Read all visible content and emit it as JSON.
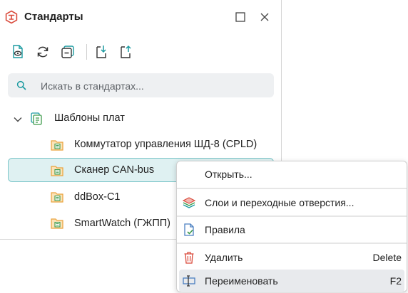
{
  "panel": {
    "title": "Стандарты",
    "icons": {
      "app": "standards-logo-icon",
      "maximize": "maximize-icon",
      "close": "close-icon"
    }
  },
  "toolbar": {
    "buttons": [
      {
        "name": "view-standard-button",
        "icon": "document-eye-icon"
      },
      {
        "name": "refresh-button",
        "icon": "refresh-icon"
      },
      {
        "name": "collapse-all-button",
        "icon": "collapse-icon"
      },
      {
        "name": "import-button",
        "icon": "import-icon"
      },
      {
        "name": "export-button",
        "icon": "export-icon"
      }
    ]
  },
  "search": {
    "placeholder": "Искать в стандартах...",
    "value": ""
  },
  "tree": {
    "root": {
      "label": "Шаблоны плат",
      "expanded": true,
      "icon": "board-templates-icon"
    },
    "items": [
      {
        "label": "Коммутатор управления ШД-8 (CPLD)",
        "icon": "folder-board-icon",
        "selected": false
      },
      {
        "label": "Сканер CAN-bus",
        "icon": "folder-board-icon",
        "selected": true
      },
      {
        "label": "ddBox-C1",
        "icon": "folder-board-icon",
        "selected": false
      },
      {
        "label": "SmartWatch (ГЖПП)",
        "icon": "folder-board-icon",
        "selected": false
      }
    ]
  },
  "context_menu": {
    "items": [
      {
        "label": "Открыть...",
        "shortcut": "",
        "icon": ""
      },
      {
        "label": "Слои и переходные отверстия...",
        "shortcut": "",
        "icon": "layers-icon"
      },
      {
        "label": "Правила",
        "shortcut": "",
        "icon": "rules-document-icon"
      },
      {
        "label": "Удалить",
        "shortcut": "Delete",
        "icon": "trash-icon"
      },
      {
        "label": "Переименовать",
        "shortcut": "F2",
        "icon": "rename-icon",
        "hovered": true
      }
    ]
  },
  "colors": {
    "accent": "#1a9aa0",
    "selection_bg": "#dff1f2",
    "selection_border": "#7cc6c9",
    "search_bg": "#eef0f2",
    "brand_red": "#d9493a",
    "folder": "#e9a23b",
    "hover_bg": "#e8eaed"
  }
}
